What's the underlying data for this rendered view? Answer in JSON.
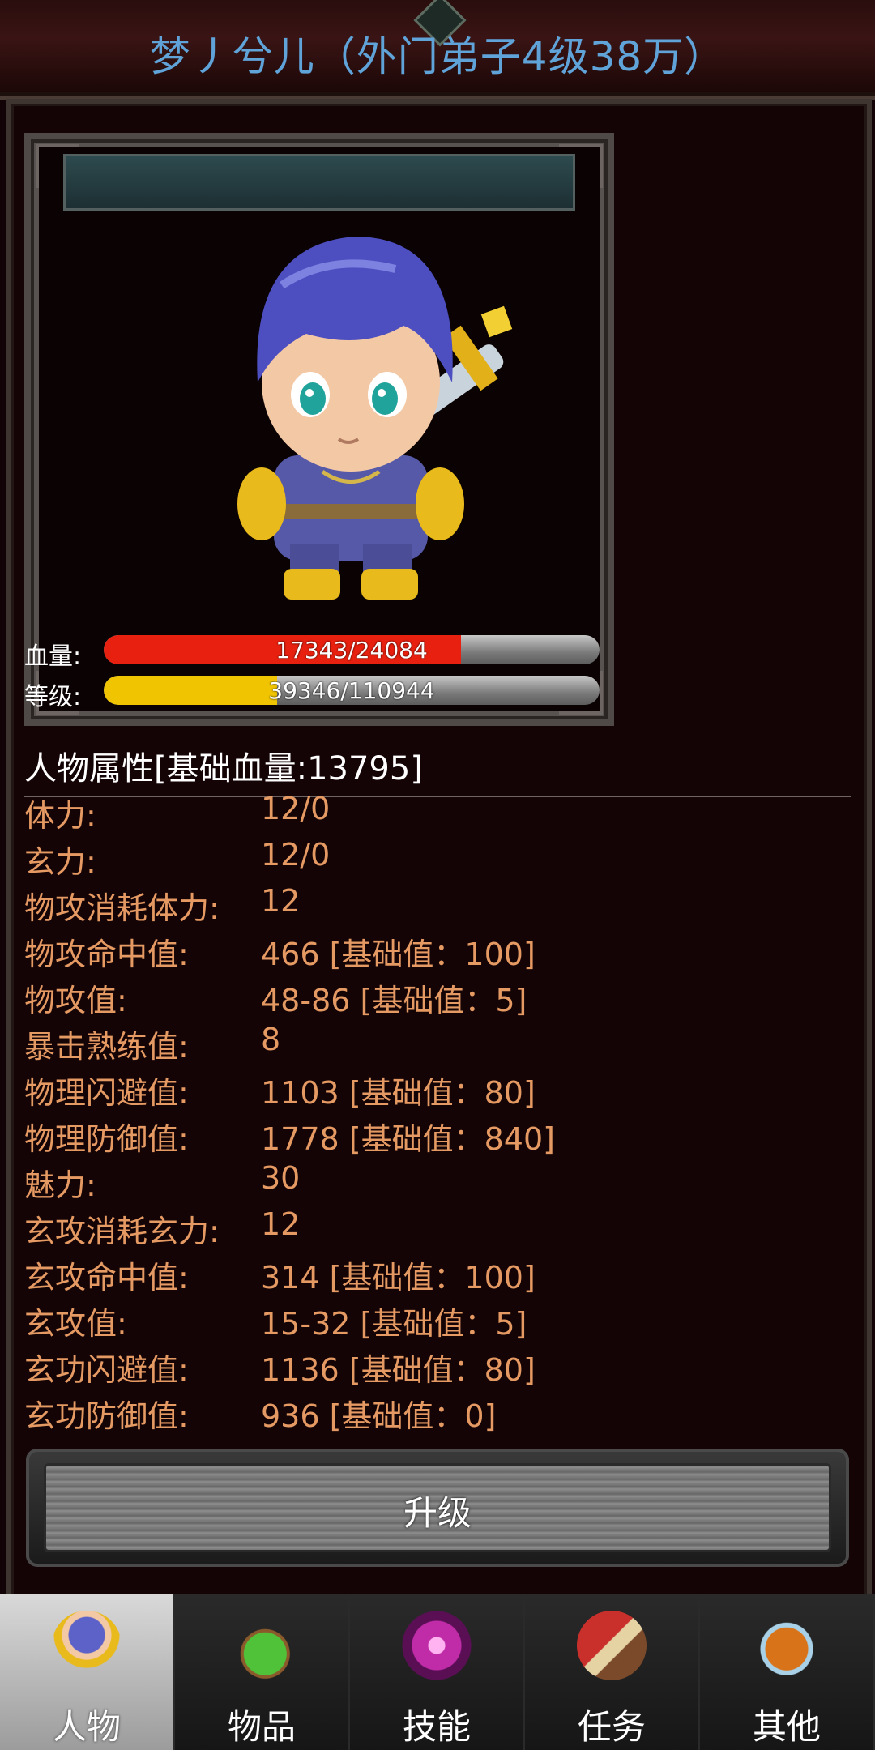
{
  "header": {
    "title": "梦丿兮儿（外门弟子4级38万）"
  },
  "status": {
    "hp_label": "血量:",
    "hp_text": "17343/24084",
    "hp_fraction": 0.72,
    "level_label": "等级:",
    "level_text": "39346/110944",
    "level_fraction": 0.35
  },
  "attributes": {
    "header": "人物属性[基础血量:13795]",
    "rows": [
      {
        "key": "体力:",
        "value": "12/0"
      },
      {
        "key": "玄力:",
        "value": "12/0"
      },
      {
        "key": "物攻消耗体力:",
        "value": "12"
      },
      {
        "key": "物攻命中值:",
        "value": "466 [基础值：100]"
      },
      {
        "key": "物攻值:",
        "value": "48-86 [基础值：5]"
      },
      {
        "key": "暴击熟练值:",
        "value": "8"
      },
      {
        "key": "物理闪避值:",
        "value": "1103 [基础值：80]"
      },
      {
        "key": "物理防御值:",
        "value": "1778 [基础值：840]"
      },
      {
        "key": "魅力:",
        "value": "30"
      },
      {
        "key": "玄攻消耗玄力:",
        "value": "12"
      },
      {
        "key": "玄攻命中值:",
        "value": "314 [基础值：100]"
      },
      {
        "key": "玄攻值:",
        "value": "15-32 [基础值：5]"
      },
      {
        "key": "玄功闪避值:",
        "value": "1136 [基础值：80]"
      },
      {
        "key": "玄功防御值:",
        "value": "936 [基础值：0]"
      }
    ]
  },
  "actions": {
    "upgrade_label": "升级"
  },
  "tabs": [
    {
      "label": "人物",
      "icon": "character-icon",
      "active": true
    },
    {
      "label": "物品",
      "icon": "potion-icon",
      "active": false
    },
    {
      "label": "技能",
      "icon": "skill-orb-icon",
      "active": false
    },
    {
      "label": "任务",
      "icon": "quest-icon",
      "active": false
    },
    {
      "label": "其他",
      "icon": "other-icon",
      "active": false
    }
  ],
  "colors": {
    "title": "#5fa3d8",
    "hp_bar": "#e8200f",
    "level_bar": "#f0c400",
    "attribute_text": "#e69a63"
  }
}
